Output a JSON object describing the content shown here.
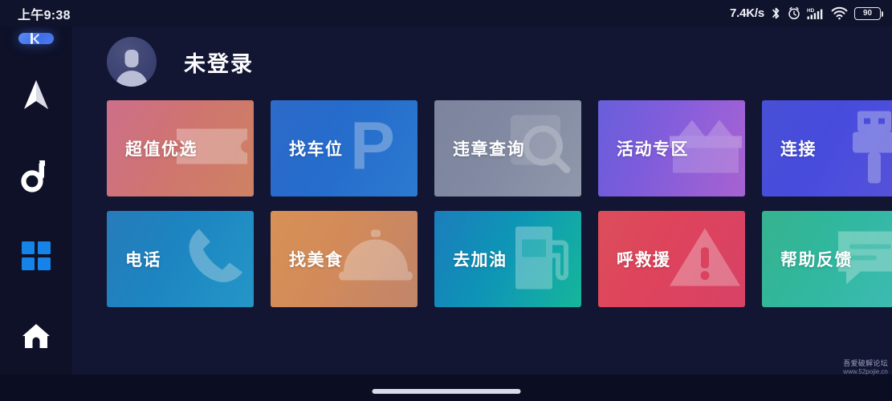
{
  "status_bar": {
    "clock": "上午9:38",
    "net_speed": "7.4K/s",
    "bluetooth_icon": "bluetooth-icon",
    "alarm_icon": "alarm-clock-icon",
    "hd_label": "HD",
    "signal_icon": "cellular-signal-icon",
    "wifi_icon": "wifi-icon",
    "battery_level": "90"
  },
  "sidebar": {
    "collapse_label": "",
    "items": [
      {
        "name": "navigation",
        "icon": "navigation-arrow-icon"
      },
      {
        "name": "music",
        "icon": "music-note-icon"
      },
      {
        "name": "apps",
        "icon": "app-grid-icon"
      },
      {
        "name": "home",
        "icon": "home-icon"
      }
    ]
  },
  "profile": {
    "name": "未登录",
    "avatar_icon": "user-avatar-icon"
  },
  "tiles": [
    {
      "label": "超值优选",
      "icon": "coupon-ticket-icon",
      "gradient_from": "#c96581",
      "gradient_to": "#dd8c6a",
      "accent": "#f3bda9"
    },
    {
      "label": "找车位",
      "icon": "parking-p-icon",
      "gradient_from": "#1f5fc4",
      "gradient_to": "#2f83e0",
      "accent": "#8cc2f5"
    },
    {
      "label": "违章查询",
      "icon": "magnifier-icon",
      "gradient_from": "#737b96",
      "gradient_to": "#9aa3b8",
      "accent": "#cfd6e4"
    },
    {
      "label": "活动专区",
      "icon": "gift-box-icon",
      "gradient_from": "#5e53d8",
      "gradient_to": "#b469e0",
      "accent": "#dcb6f5"
    },
    {
      "label": "连接",
      "icon": "usb-plug-icon",
      "gradient_from": "#3a43d2",
      "gradient_to": "#5e59e8",
      "accent": "#b9bcf7"
    },
    {
      "label": "电话",
      "icon": "phone-handset-icon",
      "gradient_from": "#1772b4",
      "gradient_to": "#27a1d6",
      "accent": "#8fd6f2"
    },
    {
      "label": "找美食",
      "icon": "food-cloche-icon",
      "gradient_from": "#d58949",
      "gradient_to": "#cf8f72",
      "accent": "#f6cdae"
    },
    {
      "label": "去加油",
      "icon": "fuel-pump-icon",
      "gradient_from": "#0b74b8",
      "gradient_to": "#17c3a6",
      "accent": "#8df0db"
    },
    {
      "label": "呼救援",
      "icon": "warning-triangle-icon",
      "gradient_from": "#d9414f",
      "gradient_to": "#e8476e",
      "accent": "#ffb3bf"
    },
    {
      "label": "帮助反馈",
      "icon": "speech-bubble-icon",
      "gradient_from": "#28ad87",
      "gradient_to": "#44c9c2",
      "accent": "#b6f0e8"
    }
  ],
  "watermark": {
    "line1": "吾爱破解论坛",
    "line2": "www.52pojie.cn"
  }
}
